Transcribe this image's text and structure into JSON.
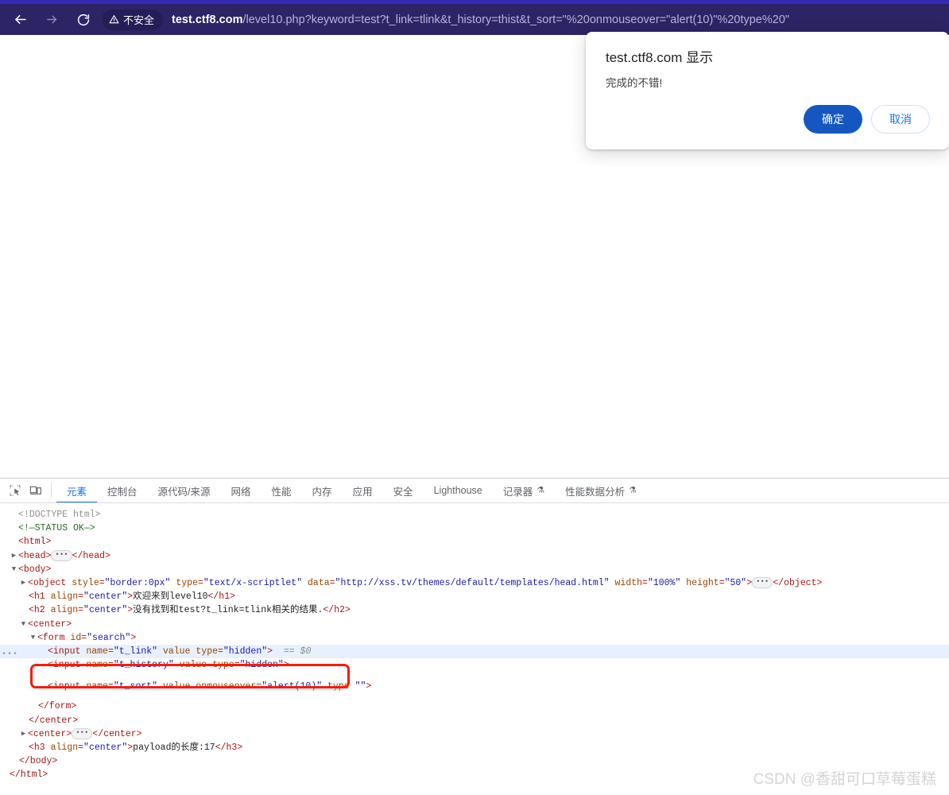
{
  "browser": {
    "back_label": "Back",
    "forward_label": "Forward",
    "reload_label": "Reload",
    "security_label": "不安全",
    "url_host": "test.ctf8.com",
    "url_path": "/level10.php?keyword=test?t_link=tlink&t_history=thist&t_sort=\"%20onmouseover=\"alert(10)\"%20type%20\"",
    "toolbar_color": "#2c2465",
    "toolbar_accent": "#3529b5"
  },
  "dialog": {
    "title": "test.ctf8.com 显示",
    "message": "完成的不错!",
    "confirm_label": "确定",
    "cancel_label": "取消",
    "confirm_color": "#1557c0",
    "cancel_text_color": "#1a73e8"
  },
  "devtools": {
    "inspect_icon": "inspect-element-icon",
    "device_icon": "device-toolbar-icon",
    "active_tab": "元素",
    "tabs": [
      {
        "label": "元素",
        "active": true,
        "glyph": ""
      },
      {
        "label": "控制台",
        "active": false,
        "glyph": ""
      },
      {
        "label": "源代码/来源",
        "active": false,
        "glyph": ""
      },
      {
        "label": "网络",
        "active": false,
        "glyph": ""
      },
      {
        "label": "性能",
        "active": false,
        "glyph": ""
      },
      {
        "label": "内存",
        "active": false,
        "glyph": ""
      },
      {
        "label": "应用",
        "active": false,
        "glyph": ""
      },
      {
        "label": "安全",
        "active": false,
        "glyph": ""
      },
      {
        "label": "Lighthouse",
        "active": false,
        "glyph": ""
      },
      {
        "label": "记录器",
        "active": false,
        "glyph": "⚗"
      },
      {
        "label": "性能数据分析",
        "active": false,
        "glyph": "⚗"
      }
    ],
    "accent_color": "#1a73e8",
    "selected_row_color": "#e8f0fe",
    "annotation_color": "#fa1a0c"
  },
  "dom": {
    "doctype": "<!DOCTYPE html>",
    "status_comment": "<!—STATUS OK—>",
    "html_open": "<html>",
    "head_open": "<head>",
    "head_close": "</head>",
    "body_open": "<body>",
    "object": {
      "open": "<object",
      "attr_style": "style",
      "val_style": "\"border:0px\"",
      "attr_type": "type",
      "val_type": "\"text/x-scriptlet\"",
      "attr_data": "data",
      "val_data": "\"http://xss.tv/themes/default/templates/head.html\"",
      "attr_width": "width",
      "val_width": "\"100%\"",
      "attr_height": "height",
      "val_height": "\"50\"",
      "close_bracket": ">",
      "close": "</object>"
    },
    "h1": {
      "open": "<h1",
      "attr": "align",
      "val": "\"center\"",
      "gt": ">",
      "text": "欢迎来到level10",
      "close": "</h1>"
    },
    "h2": {
      "open": "<h2",
      "attr": "align",
      "val": "\"center\"",
      "gt": ">",
      "text": "没有找到和test?t_link=tlink相关的结果.",
      "close": "</h2>"
    },
    "center_open": "<center>",
    "center_close": "</center>",
    "form": {
      "open": "<form",
      "attr": "id",
      "val": "\"search\"",
      "gt": ">",
      "close": "</form>"
    },
    "input_tlink": {
      "open": "<input",
      "attr_name": "name",
      "val_name": "\"t_link\"",
      "attr_value": "value",
      "attr_type": "type",
      "val_type": "\"hidden\"",
      "gt": ">",
      "selected_marker": "== $0"
    },
    "input_thistory": {
      "open": "<input",
      "attr_name": "name",
      "val_name": "\"t_history\"",
      "attr_value": "value",
      "attr_type": "type",
      "val_type": "\"hidden\"",
      "gt": ">"
    },
    "input_tsort": {
      "open": "<input",
      "attr_name": "name",
      "val_name": "\"t_sort\"",
      "attr_value": "value",
      "attr_onmouseover": "onmouseover",
      "val_onmouseover": "\"alert(10)\"",
      "attr_type": "type",
      "val_type": "\"\"",
      "gt": ">"
    },
    "center2_open": "<center>",
    "center2_close": "</center>",
    "h3": {
      "open": "<h3",
      "attr": "align",
      "val": "\"center\"",
      "gt": ">",
      "text": "payload的长度:17",
      "close": "</h3>"
    },
    "body_close": "</body>",
    "html_close": "</html>"
  },
  "watermark": {
    "text": "CSDN @香甜可口草莓蛋糕"
  }
}
